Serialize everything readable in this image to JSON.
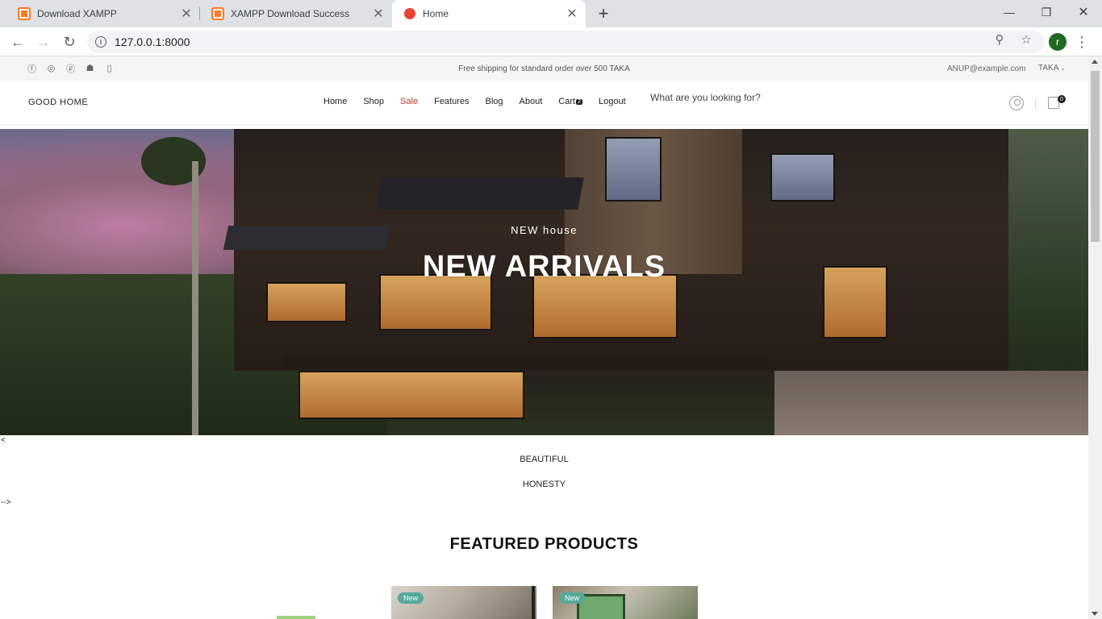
{
  "browser": {
    "tabs": [
      {
        "title": "Download XAMPP",
        "icon": "xampp-icon"
      },
      {
        "title": "XAMPP Download Success",
        "icon": "xampp-icon"
      },
      {
        "title": "Home",
        "icon": "site-dot-icon"
      }
    ],
    "active_tab": 2,
    "url": "127.0.0.1:8000",
    "profile_initial": "r"
  },
  "topbar": {
    "social_icons": [
      "facebook-icon",
      "instagram-icon",
      "pinterest-icon",
      "snapchat-icon",
      "mobile-icon"
    ],
    "shipping_text": "Free shipping for standard order over 500 TAKA",
    "email": "ANUP@example.com",
    "currency": "TAKA"
  },
  "nav": {
    "logo": "GOOD HOME",
    "menu": {
      "home": "Home",
      "shop": "Shop",
      "sale": "Sale",
      "features": "Features",
      "blog": "Blog",
      "about": "About",
      "cart": "Cart",
      "cart_count": "2",
      "logout": "Logout"
    },
    "search_placeholder": "What are you looking for?",
    "bag_count": "0",
    "sale_color": "#c0392b"
  },
  "hero": {
    "subtitle": "NEW house",
    "title": "NEW ARRIVALS"
  },
  "page": {
    "stray_open": "<",
    "tagline_1": "BEAUTIFUL",
    "tagline_2": "HONESTY",
    "stray_close": "-->",
    "featured_title": "FEATURED PRODUCTS"
  },
  "products": [
    {
      "badge": "New"
    },
    {
      "badge": "New"
    }
  ],
  "colors": {
    "badge": "#56a89a",
    "accent_sale": "#c0392b"
  }
}
